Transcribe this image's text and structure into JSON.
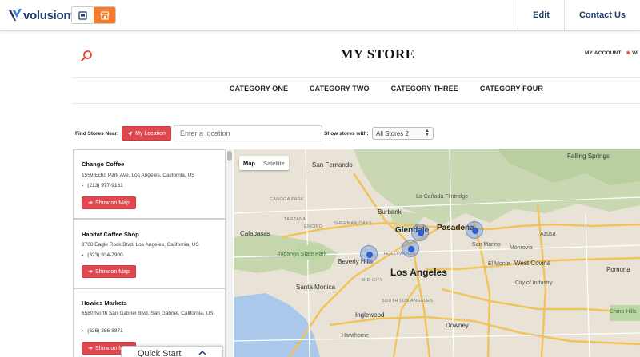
{
  "admin": {
    "brand": "volusion",
    "edit_label": "Edit",
    "contact_label": "Contact Us",
    "brand_color": "#1a3b6b",
    "accent_color": "#f47b2a"
  },
  "header": {
    "store_title": "MY STORE",
    "my_account": "MY ACCOUNT",
    "wishlist": "WI"
  },
  "nav": [
    "CATEGORY ONE",
    "CATEGORY TWO",
    "CATEGORY THREE",
    "CATEGORY FOUR"
  ],
  "locator": {
    "find_label": "Find Stores Near:",
    "my_location": "My Location",
    "location_placeholder": "Enter a location",
    "show_label": "Show stores with:",
    "stores_selected": "All Stores 2"
  },
  "stores": [
    {
      "name": "Chango Coffee",
      "address": "1559 Echo Park Ave, Los Angeles, California, US",
      "phone": "(213) 977-9161",
      "button": "Show on Map"
    },
    {
      "name": "Habitat Coffee Shop",
      "address": "3708 Eagle Rock Blvd, Los Angeles, California, US",
      "phone": "(323) 934-7900",
      "button": "Show on Map"
    },
    {
      "name": "Howies Markets",
      "address": "6580 North San Gabriel Blvd, San Gabriel, California, US",
      "phone": "(626) 286-8871",
      "button": "Show on Map"
    }
  ],
  "map": {
    "tab_map": "Map",
    "tab_satellite": "Satellite",
    "labels": {
      "san_fernando": "San Fernando",
      "burbank": "Burbank",
      "glendale": "Glendale",
      "pasadena": "Pasadena",
      "los_angeles": "Los Angeles",
      "beverly_hills": "Beverly Hills",
      "santa_monica": "Santa Monica",
      "inglewood": "Inglewood",
      "downey": "Downey",
      "west_covina": "West Covina",
      "pomona": "Pomona",
      "azusa": "Azusa",
      "calabasas": "Calabasas",
      "la_canada": "La Cañada Flintridge",
      "falling_springs": "Falling Springs",
      "topanga": "Topanga State Park",
      "city_of_industry": "City of Industry",
      "el_monte": "El Monte",
      "canoga_park": "CANOGA PARK",
      "mid_city": "MID-CITY",
      "south_la": "SOUTH LOS ANGELES",
      "encino": "ENCINO",
      "tarzana": "TARZANA",
      "sherman_oaks": "SHERMAN OAKS",
      "hollywood": "HOLLYWOOD",
      "monrovia": "Monrovia",
      "san_marino": "San Marino",
      "hawthorne": "Hawthorne",
      "chino_hills": "Chino Hills"
    }
  },
  "quickstart": {
    "label": "Quick Start"
  }
}
